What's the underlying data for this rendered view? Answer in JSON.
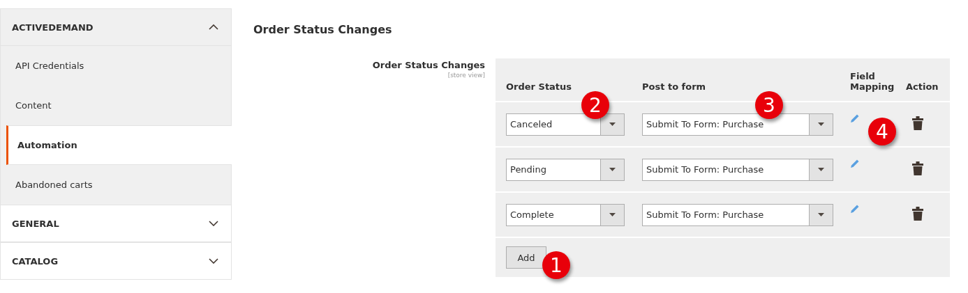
{
  "sidebar": {
    "sections": [
      {
        "title": "ACTIVEDEMAND",
        "expanded": true,
        "items": [
          {
            "label": "API Credentials",
            "selected": false
          },
          {
            "label": "Content",
            "selected": false
          },
          {
            "label": "Automation",
            "selected": true
          },
          {
            "label": "Abandoned carts",
            "selected": false
          }
        ]
      },
      {
        "title": "GENERAL",
        "expanded": false
      },
      {
        "title": "CATALOG",
        "expanded": false
      }
    ]
  },
  "section_title": "Order Status Changes",
  "field": {
    "label": "Order Status Changes",
    "scope": "[store view]"
  },
  "table": {
    "columns": [
      "Order Status",
      "Post to form",
      "Field Mapping",
      "Action"
    ],
    "rows": [
      {
        "order_status": "Canceled",
        "post_to_form": "Submit To Form: Purchase"
      },
      {
        "order_status": "Pending",
        "post_to_form": "Submit To Form: Purchase"
      },
      {
        "order_status": "Complete",
        "post_to_form": "Submit To Form: Purchase"
      }
    ],
    "add_button": "Add"
  },
  "markers": [
    "1",
    "2",
    "3",
    "4"
  ]
}
